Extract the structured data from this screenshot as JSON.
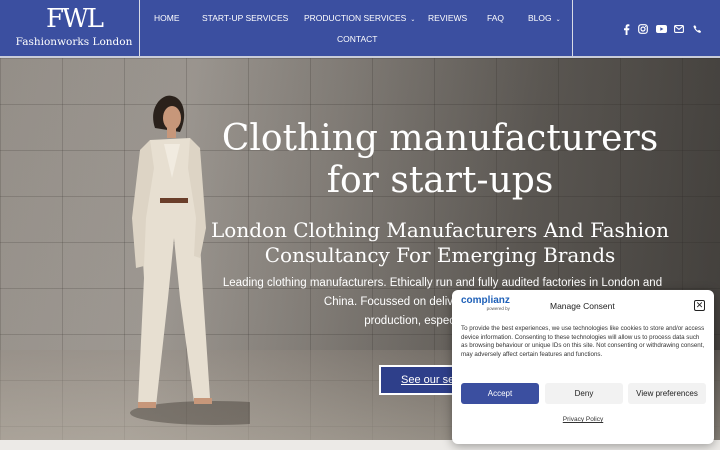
{
  "header": {
    "logo_mark": "FWL",
    "logo_text": "Fashionworks London",
    "nav": [
      {
        "label": "HOME"
      },
      {
        "label": "START-UP SERVICES"
      },
      {
        "label": "PRODUCTION SERVICES"
      },
      {
        "label": "REVIEWS"
      },
      {
        "label": "FAQ"
      },
      {
        "label": "BLOG"
      },
      {
        "label": "CONTACT"
      }
    ],
    "social_icons": [
      "facebook-icon",
      "instagram-icon",
      "youtube-icon",
      "email-icon",
      "phone-icon"
    ]
  },
  "hero": {
    "title_line1": "Clothing manufacturers",
    "title_line2": "for start-ups",
    "subtitle_line1": "London Clothing Manufacturers And Fashion",
    "subtitle_line2": "Consultancy For Emerging Brands",
    "desc_line1": "Leading clothing manufacturers. Ethically run and fully audited factories in London and",
    "desc_line2": "China. Focussed on delivering mid to high-end",
    "desc_line3": "production, especially for start-",
    "cta_label": "See our serv"
  },
  "consent": {
    "brand": "complianz",
    "brand_powered": "powered by",
    "title": "Manage Consent",
    "text": "To provide the best experiences, we use technologies like cookies to store and/or access device information. Consenting to these technologies will allow us to process data such as browsing behaviour or unique IDs on this site. Not consenting or withdrawing consent, may adversely affect certain features and functions.",
    "accept_label": "Accept",
    "deny_label": "Deny",
    "prefs_label": "View preferences",
    "policy_label": "Privacy Policy"
  },
  "colors": {
    "brand_blue": "#3b4fa0",
    "accent_blue": "#1e60b8"
  }
}
